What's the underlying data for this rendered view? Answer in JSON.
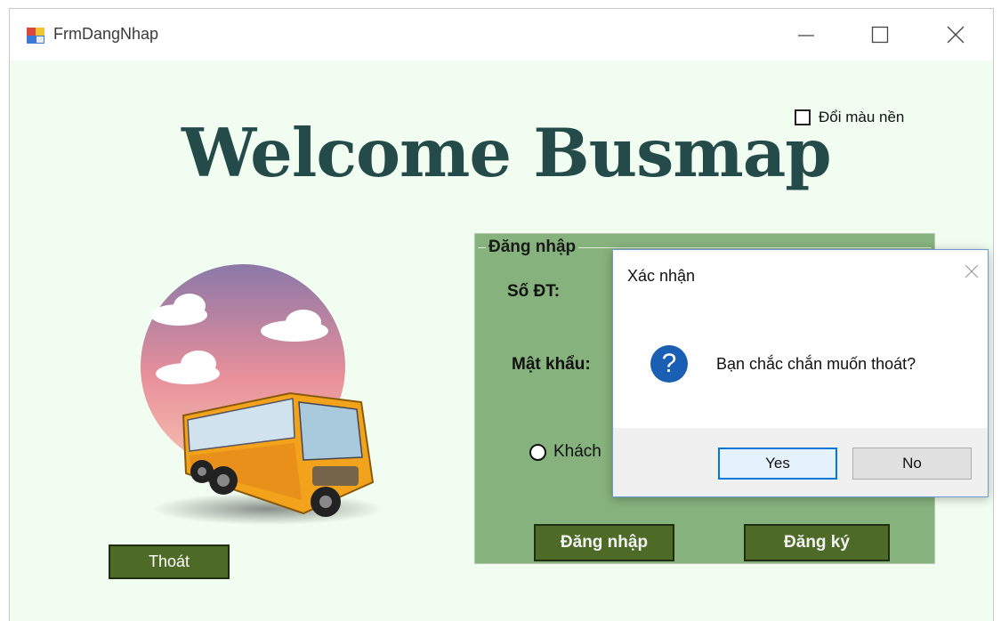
{
  "window": {
    "title": "FrmDangNhap"
  },
  "main": {
    "background_toggle_label": "Đổi màu nền",
    "welcome_text": "Welcome Busmap",
    "exit_label": "Thoát"
  },
  "login": {
    "group_title": "Đăng nhập",
    "phone_label": "Số ĐT:",
    "password_label": "Mật khẩu:",
    "radio_label": "Khách",
    "login_button": "Đăng nhập",
    "register_button": "Đăng ký"
  },
  "dialog": {
    "title": "Xác nhận",
    "message": "Bạn chắc chắn muốn thoát?",
    "yes_label": "Yes",
    "no_label": "No",
    "icon": "question-icon"
  },
  "colors": {
    "form_background": "#f0fdf0",
    "group_background": "#86b27d",
    "button_green": "#4e6a27",
    "welcome_text": "#244b49"
  }
}
